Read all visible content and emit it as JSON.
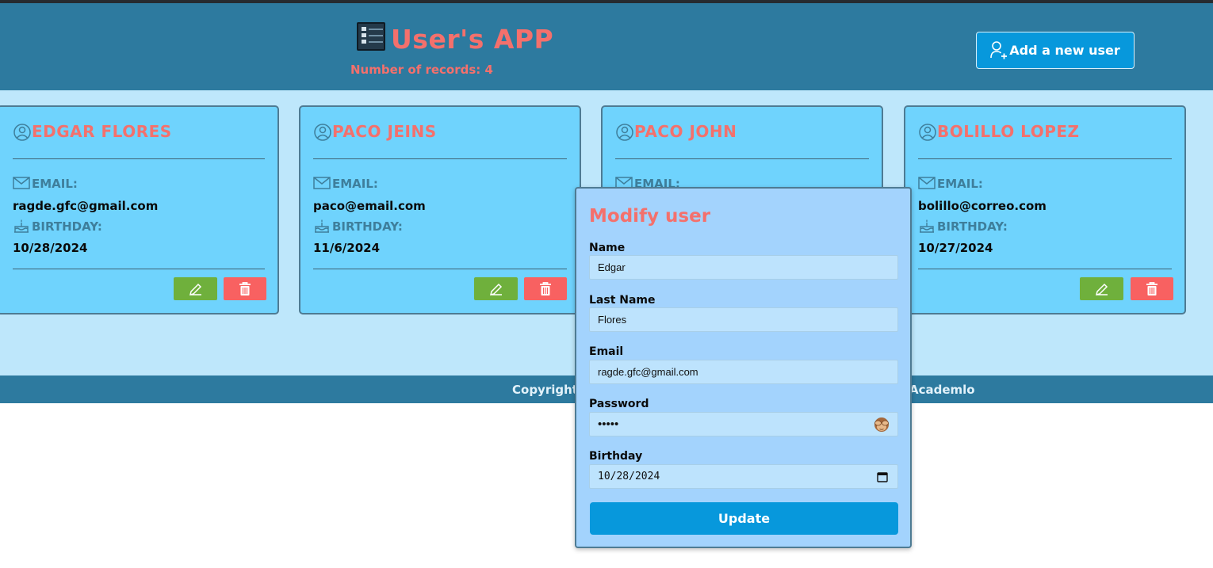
{
  "header": {
    "title": "User's APP",
    "records_label": "Number of records: 4",
    "add_button_label": "Add a new user",
    "colors": {
      "bar": "#2d7a9f",
      "accent": "#f4706c",
      "button": "#0798dc"
    }
  },
  "cards": [
    {
      "name": "Edgar Flores",
      "email_label": "Email:",
      "email": "ragde.gfc@gmail.com",
      "birthday_label": "Birthday:",
      "birthday": "10/28/2024"
    },
    {
      "name": "Paco Jeins",
      "email_label": "Email:",
      "email": "paco@email.com",
      "birthday_label": "Birthday:",
      "birthday": "11/6/2024"
    },
    {
      "name": "Paco John",
      "email_label": "Email:",
      "email": "",
      "birthday_label": "",
      "birthday": ""
    },
    {
      "name": "Bolillo Lopez",
      "email_label": "Email:",
      "email": "bolillo@correo.com",
      "birthday_label": "Birthday:",
      "birthday": "10/27/2024"
    }
  ],
  "icons": {
    "user": "user-circle-icon",
    "email": "envelope-icon",
    "birthday": "cake-icon",
    "edit": "pencil-icon",
    "delete": "trash-icon",
    "add": "user-plus-icon",
    "password_toggle": "see-no-evil-monkey-icon",
    "date_picker": "calendar-icon"
  },
  "footer": {
    "left_text": "Copyright",
    "right_text": "Academlo"
  },
  "modal": {
    "title": "Modify user",
    "fields": {
      "name": {
        "label": "Name",
        "value": "Edgar"
      },
      "last_name": {
        "label": "Last Name",
        "value": "Flores"
      },
      "email": {
        "label": "Email",
        "value": "ragde.gfc@gmail.com"
      },
      "password": {
        "label": "Password",
        "value": "•••••"
      },
      "birthday": {
        "label": "Birthday",
        "value": "10/28/2024"
      }
    },
    "submit_label": "Update"
  }
}
